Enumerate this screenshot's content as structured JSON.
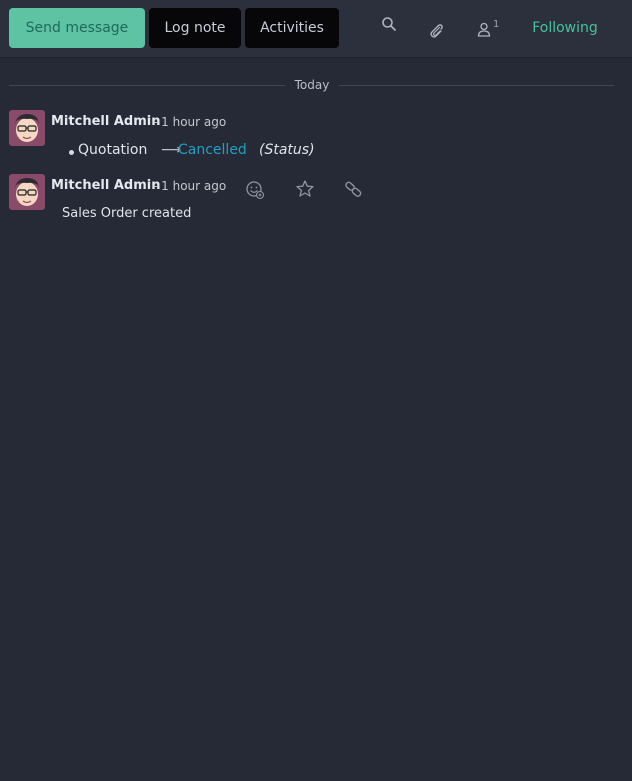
{
  "chatter": {
    "send_message_label": "Send message",
    "log_note_label": "Log note",
    "activities_label": "Activities",
    "followers_count": "1",
    "following_label": "Following"
  },
  "thread": {
    "date_separator": "Today",
    "messages": [
      {
        "author": "Mitchell Admin",
        "date": "- 1 hour ago",
        "tracking": {
          "field_old": "Quotation",
          "arrow": "⟶",
          "field_new": "Cancelled",
          "field_name": "(Status)"
        }
      },
      {
        "author": "Mitchell Admin",
        "date": "- 1 hour ago",
        "body": "Sales Order created"
      }
    ]
  },
  "colors": {
    "background": "#262a36",
    "topbar": "#2b303c",
    "primary_button": "#5ec3a3",
    "following": "#45c29f",
    "tracking_new_value": "#1f9fc4"
  }
}
